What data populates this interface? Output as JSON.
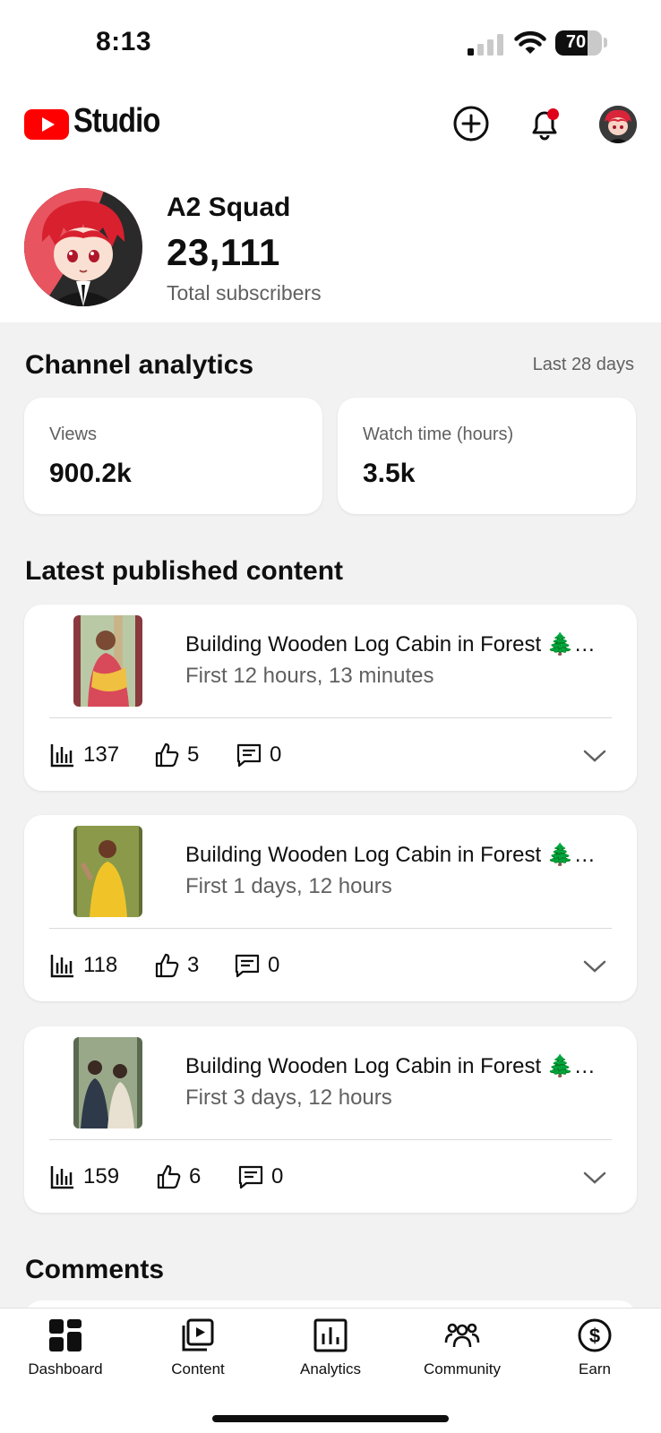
{
  "status_bar": {
    "time": "8:13",
    "battery": "70",
    "battery_level": 0.7
  },
  "header": {
    "brand": "Studio",
    "icons": [
      "create-icon",
      "notifications-bell-icon",
      "account-avatar"
    ],
    "brand_color": "#ff0000",
    "notification_dot_color": "#e1001b"
  },
  "channel": {
    "name": "A2 Squad",
    "subscribers": "23,111",
    "subscribers_label": "Total subscribers"
  },
  "analytics": {
    "title": "Channel analytics",
    "period": "Last 28 days",
    "stats": [
      {
        "label": "Views",
        "value": "900.2k"
      },
      {
        "label": "Watch time (hours)",
        "value": "3.5k"
      }
    ]
  },
  "latest": {
    "title": "Latest published content",
    "items": [
      {
        "title": "Building Wooden Log Cabin in Forest 🌲…",
        "subtitle": "First 12 hours, 13 minutes",
        "views": "137",
        "likes": "5",
        "comments": "0"
      },
      {
        "title": "Building Wooden Log Cabin in Forest 🌲…",
        "subtitle": "First 1 days, 12 hours",
        "views": "118",
        "likes": "3",
        "comments": "0"
      },
      {
        "title": "Building Wooden Log Cabin in Forest 🌲…",
        "subtitle": "First 3 days, 12 hours",
        "views": "159",
        "likes": "6",
        "comments": "0"
      }
    ]
  },
  "comments": {
    "title": "Comments"
  },
  "nav": {
    "items": [
      {
        "label": "Dashboard",
        "icon": "dashboard-icon",
        "active": true
      },
      {
        "label": "Content",
        "icon": "content-icon",
        "active": false
      },
      {
        "label": "Analytics",
        "icon": "analytics-icon",
        "active": false
      },
      {
        "label": "Community",
        "icon": "community-icon",
        "active": false
      },
      {
        "label": "Earn",
        "icon": "earn-icon",
        "active": false
      }
    ]
  }
}
